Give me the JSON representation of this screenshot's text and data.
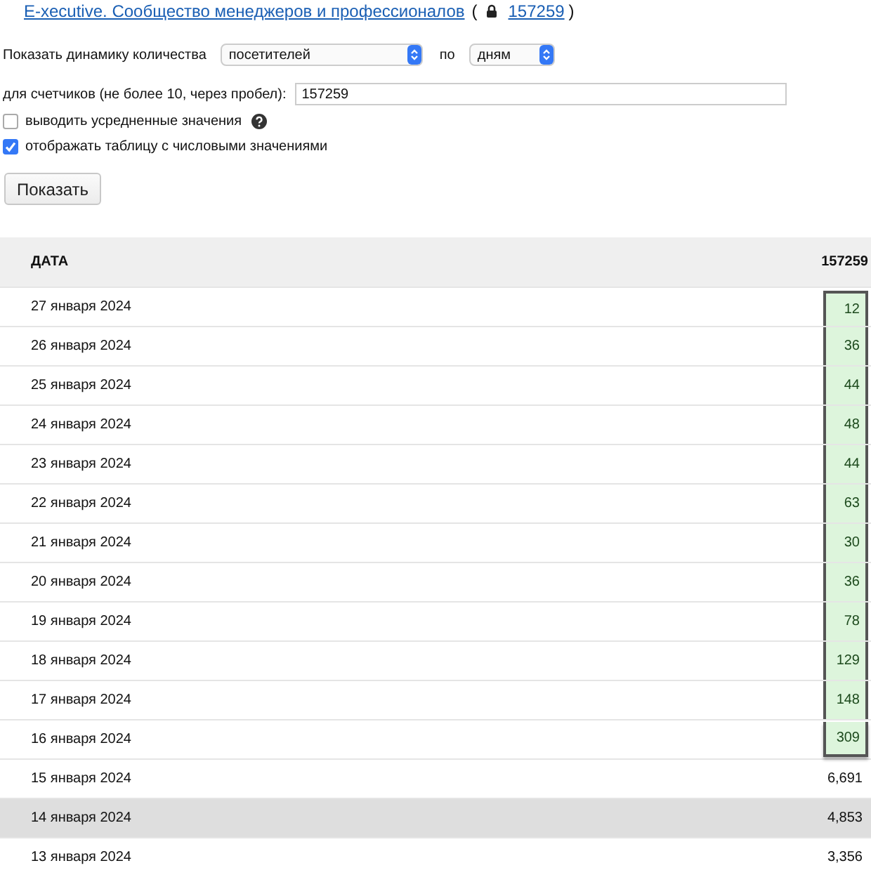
{
  "header": {
    "site_link": "E-xecutive. Сообщество менеджеров и профессионалов",
    "open_paren": "(",
    "counter_link": "157259",
    "close_paren": ")"
  },
  "filters": {
    "label": "Показать динамику количества",
    "metric": "посетителей",
    "by_label": "по",
    "period": "дням",
    "counters_label": "для счетчиков (не более 10, через пробел):",
    "counters_value": "157259"
  },
  "options": [
    {
      "label": "выводить усредненные значения",
      "checked": false,
      "help": true
    },
    {
      "label": "отображать таблицу с числовыми значениями",
      "checked": true,
      "help": false
    }
  ],
  "submit": "Показать",
  "table": {
    "columns": [
      "ДАТА",
      "157259"
    ],
    "rows": [
      {
        "date": "27 января 2024",
        "value": "12",
        "highlighted": true,
        "hovered": false
      },
      {
        "date": "26 января 2024",
        "value": "36",
        "highlighted": true,
        "hovered": false
      },
      {
        "date": "25 января 2024",
        "value": "44",
        "highlighted": true,
        "hovered": false
      },
      {
        "date": "24 января 2024",
        "value": "48",
        "highlighted": true,
        "hovered": false
      },
      {
        "date": "23 января 2024",
        "value": "44",
        "highlighted": true,
        "hovered": false
      },
      {
        "date": "22 января 2024",
        "value": "63",
        "highlighted": true,
        "hovered": false
      },
      {
        "date": "21 января 2024",
        "value": "30",
        "highlighted": true,
        "hovered": false
      },
      {
        "date": "20 января 2024",
        "value": "36",
        "highlighted": true,
        "hovered": false
      },
      {
        "date": "19 января 2024",
        "value": "78",
        "highlighted": true,
        "hovered": false
      },
      {
        "date": "18 января 2024",
        "value": "129",
        "highlighted": true,
        "hovered": false
      },
      {
        "date": "17 января 2024",
        "value": "148",
        "highlighted": true,
        "hovered": false
      },
      {
        "date": "16 января 2024",
        "value": "309",
        "highlighted": true,
        "hovered": false
      },
      {
        "date": "15 января 2024",
        "value": "6,691",
        "highlighted": false,
        "hovered": false
      },
      {
        "date": "14 января 2024",
        "value": "4,853",
        "highlighted": false,
        "hovered": true
      },
      {
        "date": "13 января 2024",
        "value": "3,356",
        "highlighted": false,
        "hovered": false
      }
    ]
  }
}
